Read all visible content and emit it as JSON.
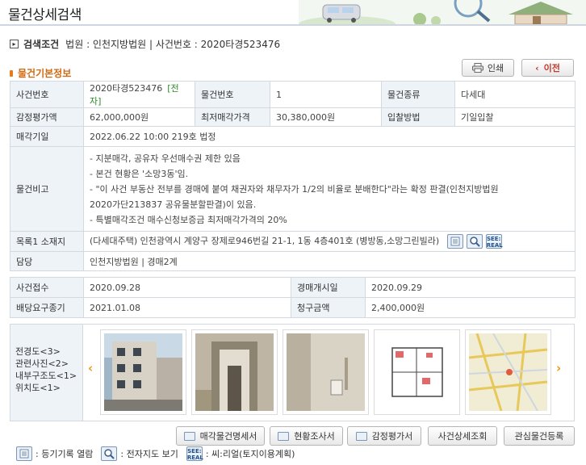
{
  "header": {
    "title": "물건상세검색"
  },
  "condition": {
    "label": "검색조건",
    "text": "법원 : 인천지방법원 | 사건번호 : 2020타경523476"
  },
  "section": {
    "title": "물건기본정보"
  },
  "actions": {
    "print": "인쇄",
    "prev": "이전"
  },
  "basic": {
    "case_no_label": "사건번호",
    "case_no": "2020타경523476",
    "etag": "[전자]",
    "item_no_label": "물건번호",
    "item_no": "1",
    "item_type_label": "물건종류",
    "item_type": "다세대",
    "appraisal_label": "감정평가액",
    "appraisal": "62,000,000원",
    "min_price_label": "최저매각가격",
    "min_price": "30,380,000원",
    "bid_method_label": "입찰방법",
    "bid_method": "기일입찰",
    "sale_date_label": "매각기일",
    "sale_date": "2022.06.22 10:00 219호 법정",
    "notes_label": "물건비고",
    "notes": [
      "- 지분매각, 공유자 우선매수권 제한 있음",
      "- 본건 현황은 '소망3동'임.",
      "- \"이 사건 부동산 전부를 경매에 붙여 채권자와 채무자가 1/2의 비율로 분배한다\"라는 확정 판결(인천지방법원",
      "2020가단213837 공유물분할판결)이 있음.",
      "- 특별매각조건 매수신청보증금 최저매각가격의 20%"
    ],
    "address_label": "목록1 소재지",
    "address": "(다세대주택) 인천광역시 계양구 장제로946번길 21-1, 1동 4층401호 (병방동,소망그린빌라)",
    "manager_label": "담당",
    "manager": "인천지방법원 | 경매2계"
  },
  "dates": {
    "received_label": "사건접수",
    "received": "2020.09.28",
    "start_label": "경매개시일",
    "start": "2020.09.29",
    "deadline_label": "배당요구종기",
    "deadline": "2021.01.08",
    "claim_label": "청구금액",
    "claim": "2,400,000원"
  },
  "photos": {
    "labels": [
      "전경도<3>",
      "관련사진<2>",
      "내부구조도<1>",
      "위치도<1>"
    ]
  },
  "buttons": {
    "b1": "매각물건명세서",
    "b2": "현황조사서",
    "b3": "감정평가서",
    "b4": "사건상세조회",
    "b5": "관심물건등록"
  },
  "legend": {
    "l1": ": 등기기록 열람",
    "l2": ": 전자지도 보기",
    "l3": ": 씨:리얼(토지이용계획)",
    "real1": "SEE:",
    "real2": "REAL"
  }
}
